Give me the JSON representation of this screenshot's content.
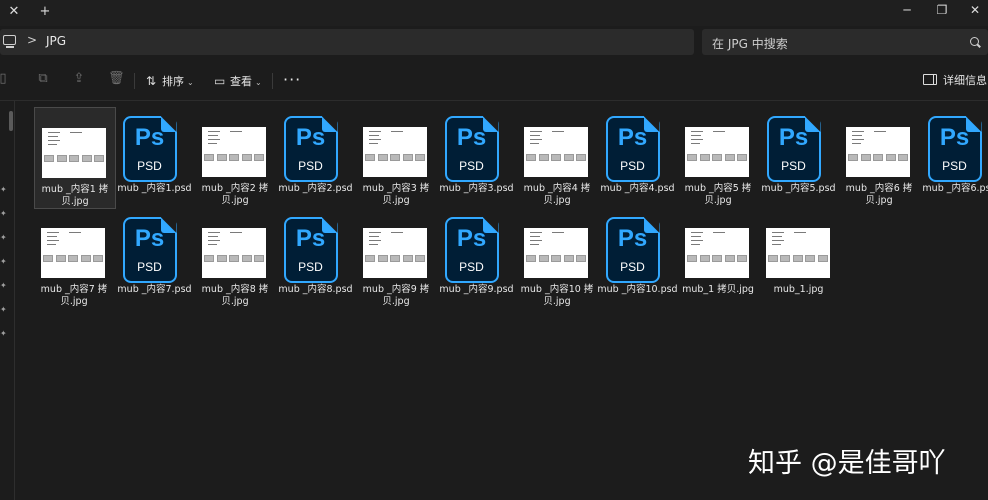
{
  "titlebar": {
    "close_tab_glyph": "✕",
    "new_tab_glyph": "+",
    "minimize_glyph": "─",
    "maximize_glyph": "❐",
    "close_glyph": "✕"
  },
  "address": {
    "separator": ">",
    "path": "JPG"
  },
  "search": {
    "placeholder": "在 JPG 中搜索"
  },
  "toolbar": {
    "sort_label": "排序",
    "view_label": "查看",
    "more_label": "···",
    "details_label": "详细信息"
  },
  "files": [
    {
      "name": "mub _内容1 拷贝.jpg",
      "type": "jpg"
    },
    {
      "name": "mub _内容1.psd",
      "type": "psd"
    },
    {
      "name": "mub _内容2 拷贝.jpg",
      "type": "jpg"
    },
    {
      "name": "mub _内容2.psd",
      "type": "psd"
    },
    {
      "name": "mub _内容3 拷贝.jpg",
      "type": "jpg"
    },
    {
      "name": "mub _内容3.psd",
      "type": "psd"
    },
    {
      "name": "mub _内容4 拷贝.jpg",
      "type": "jpg"
    },
    {
      "name": "mub _内容4.psd",
      "type": "psd"
    },
    {
      "name": "mub _内容5 拷贝.jpg",
      "type": "jpg"
    },
    {
      "name": "mub _内容5.psd",
      "type": "psd"
    },
    {
      "name": "mub _内容6 拷贝.jpg",
      "type": "jpg"
    },
    {
      "name": "mub _内容6.psd",
      "type": "psd"
    },
    {
      "name": "mub _内容7 拷贝.jpg",
      "type": "jpg"
    },
    {
      "name": "mub _内容7.psd",
      "type": "psd"
    },
    {
      "name": "mub _内容8 拷贝.jpg",
      "type": "jpg"
    },
    {
      "name": "mub _内容8.psd",
      "type": "psd"
    },
    {
      "name": "mub _内容9 拷贝.jpg",
      "type": "jpg"
    },
    {
      "name": "mub _内容9.psd",
      "type": "psd"
    },
    {
      "name": "mub _内容10 拷贝.jpg",
      "type": "jpg"
    },
    {
      "name": "mub _内容10.psd",
      "type": "psd"
    },
    {
      "name": "mub_1 拷贝.jpg",
      "type": "jpg"
    },
    {
      "name": "mub_1.jpg",
      "type": "jpg"
    }
  ],
  "psd_icon": {
    "letters": "Ps",
    "tag": "PSD",
    "accent": "#31a8ff",
    "fill": "#001e36"
  },
  "watermark": "知乎 @是佳哥吖"
}
